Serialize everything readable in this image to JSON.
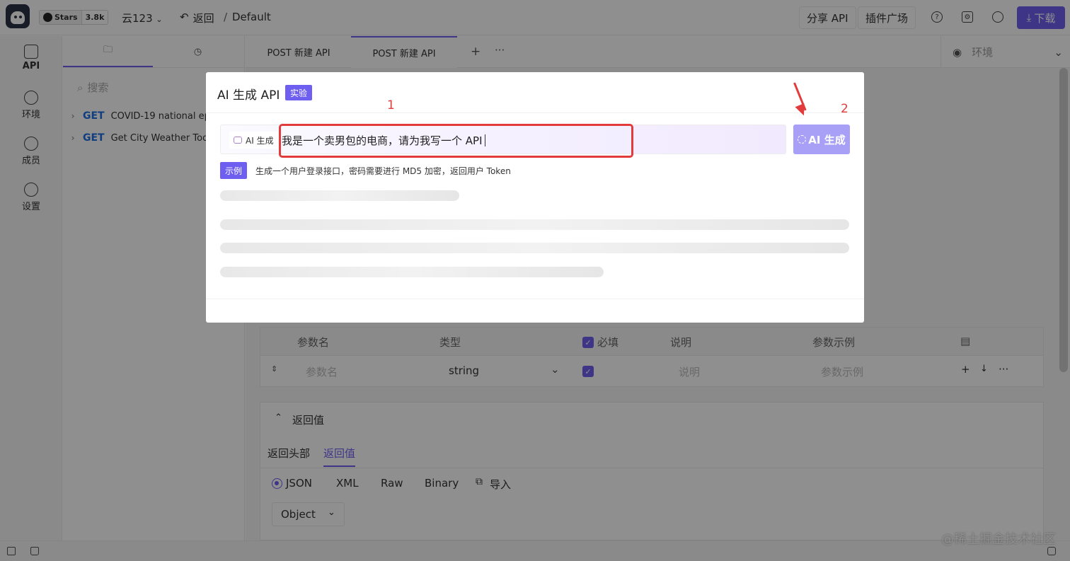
{
  "topbar": {
    "stars_label": "Stars",
    "stars_count": "3.8k",
    "workspace": "云123",
    "back_label": "返回",
    "breadcrumb_sep": "/",
    "breadcrumb": "Default",
    "share_api": "分享 API",
    "plugins": "插件广场",
    "download": "下载"
  },
  "leftnav": {
    "items": [
      {
        "label": "API",
        "icon": "api-icon"
      },
      {
        "label": "环境",
        "icon": "environment-icon"
      },
      {
        "label": "成员",
        "icon": "members-icon"
      },
      {
        "label": "设置",
        "icon": "settings-icon"
      }
    ]
  },
  "sidebar": {
    "search_placeholder": "搜索",
    "items": [
      {
        "method": "GET",
        "name": "COVID-19 national epide"
      },
      {
        "method": "GET",
        "name": "Get City Weather Today"
      }
    ]
  },
  "tabs": {
    "items": [
      {
        "label": "POST  新建 API"
      },
      {
        "label": "POST  新建 API"
      }
    ],
    "plus": "+",
    "more": "···",
    "env_placeholder": "环境"
  },
  "params_table": {
    "headers": {
      "name": "参数名",
      "type": "类型",
      "required": "必填",
      "desc": "说明",
      "example": "参数示例"
    },
    "row": {
      "name_placeholder": "参数名",
      "type": "string",
      "desc_placeholder": "说明",
      "example_placeholder": "参数示例"
    }
  },
  "response": {
    "title": "返回值",
    "tabs": [
      "返回头部",
      "返回值"
    ],
    "formats": [
      "JSON",
      "XML",
      "Raw",
      "Binary"
    ],
    "import_label": "导入",
    "root_type": "Object"
  },
  "modal": {
    "title": "AI 生成 API",
    "badge": "实验",
    "prefix_label": "AI 生成",
    "input_value": "我是一个卖男包的电商，请为我写一个 API",
    "generate_button": "AI 生成",
    "example_tag": "示例",
    "example_text": "生成一个用户登录接口，密码需要进行 MD5 加密，返回用户 Token"
  },
  "annotations": {
    "one": "1",
    "two": "2"
  },
  "watermark": "@稀土掘金技术社区",
  "colors": {
    "accent": "#6f5ff0",
    "annotation": "#e23b3b",
    "method_get": "#1f6fe6"
  }
}
